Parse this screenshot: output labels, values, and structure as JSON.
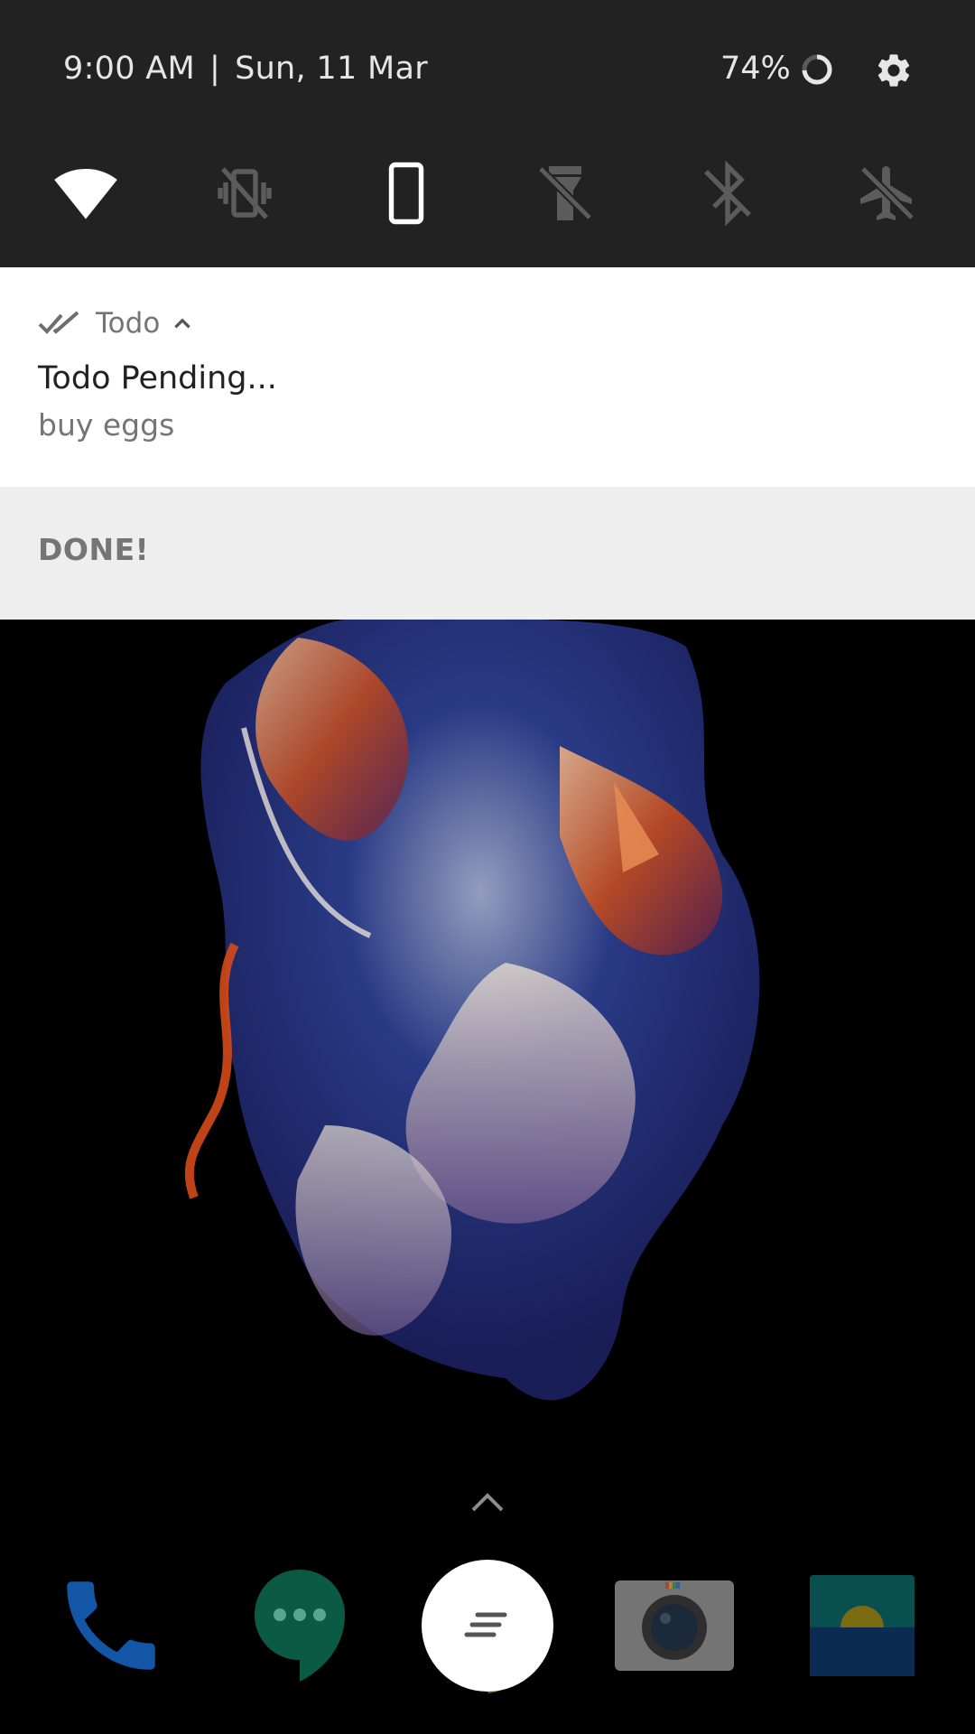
{
  "status": {
    "time": "9:00 AM",
    "separator": "|",
    "date": "Sun, 11 Mar",
    "battery": "74%"
  },
  "quick_tiles": [
    {
      "name": "wifi",
      "icon": "wifi-icon",
      "state": "on"
    },
    {
      "name": "vibrate",
      "icon": "vibrate-off-icon",
      "state": "off"
    },
    {
      "name": "portrait",
      "icon": "portrait-lock-icon",
      "state": "on"
    },
    {
      "name": "flashlight",
      "icon": "flashlight-off-icon",
      "state": "off"
    },
    {
      "name": "bluetooth",
      "icon": "bluetooth-off-icon",
      "state": "off"
    },
    {
      "name": "airplane",
      "icon": "airplane-mode-off-icon",
      "state": "off"
    }
  ],
  "notification": {
    "app_name": "Todo",
    "title": "Todo Pending...",
    "text": "buy eggs",
    "action": "DONE!"
  },
  "dock": [
    {
      "name": "Phone",
      "icon": "phone-icon"
    },
    {
      "name": "Hangouts",
      "icon": "hangouts-icon"
    },
    {
      "name": "Google",
      "icon": "google-search-icon"
    },
    {
      "name": "Camera",
      "icon": "camera-icon"
    },
    {
      "name": "Gallery",
      "icon": "gallery-icon"
    }
  ],
  "colors": {
    "panel": "#222222",
    "tile_on": "#ffffff",
    "tile_off": "#5c5c5c",
    "notification_bg": "#ffffff",
    "action_bg": "#eeeeee"
  }
}
